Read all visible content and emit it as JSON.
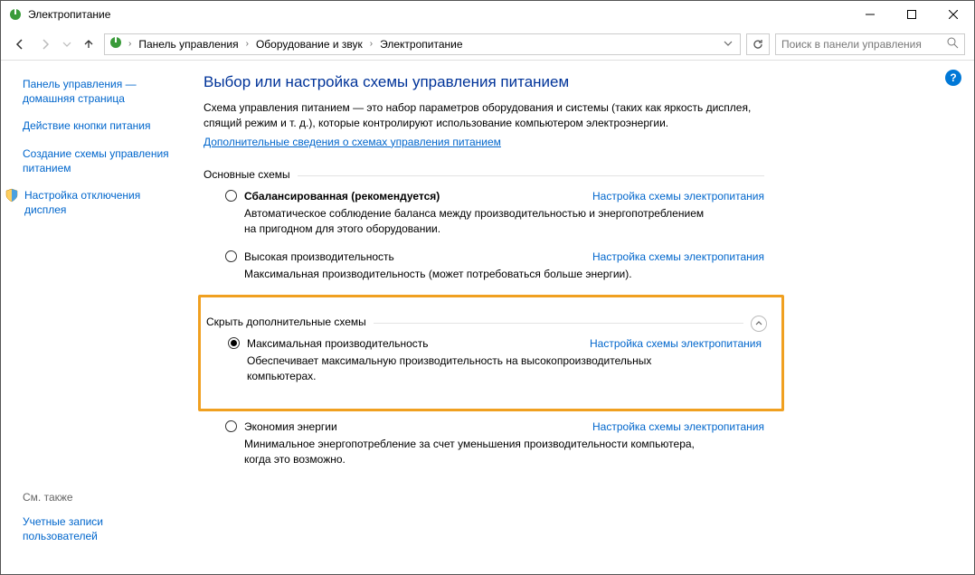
{
  "window": {
    "title": "Электропитание"
  },
  "breadcrumb": {
    "root": "Панель управления",
    "cat": "Оборудование и звук",
    "page": "Электропитание"
  },
  "search": {
    "placeholder": "Поиск в панели управления"
  },
  "sidebar": {
    "home": "Панель управления — домашняя страница",
    "button_action": "Действие кнопки питания",
    "create_plan": "Создание схемы управления питанием",
    "display_off": "Настройка отключения дисплея",
    "see_also": "См. также",
    "user_accounts": "Учетные записи пользователей"
  },
  "content": {
    "heading": "Выбор или настройка схемы управления питанием",
    "description": "Схема управления питанием — это набор параметров оборудования и системы (таких как яркость дисплея, спящий режим и т. д.), которые контролируют использование компьютером электроэнергии.",
    "learn_more": "Дополнительные сведения о схемах управления питанием",
    "basic_schemes": "Основные схемы",
    "additional_schemes": "Скрыть дополнительные схемы",
    "change_settings": "Настройка схемы электропитания",
    "plans": {
      "balanced": {
        "name": "Сбалансированная (рекомендуется)",
        "desc": "Автоматическое соблюдение баланса между производительностью и энергопотреблением на пригодном для этого оборудовании."
      },
      "high": {
        "name": "Высокая производительность",
        "desc": "Максимальная производительность (может потребоваться больше энергии)."
      },
      "ultimate": {
        "name": "Максимальная производительность",
        "desc": "Обеспечивает максимальную производительность на высокопроизводительных компьютерах."
      },
      "saver": {
        "name": "Экономия энергии",
        "desc": "Минимальное энергопотребление за счет уменьшения производительности компьютера, когда это возможно."
      }
    }
  }
}
